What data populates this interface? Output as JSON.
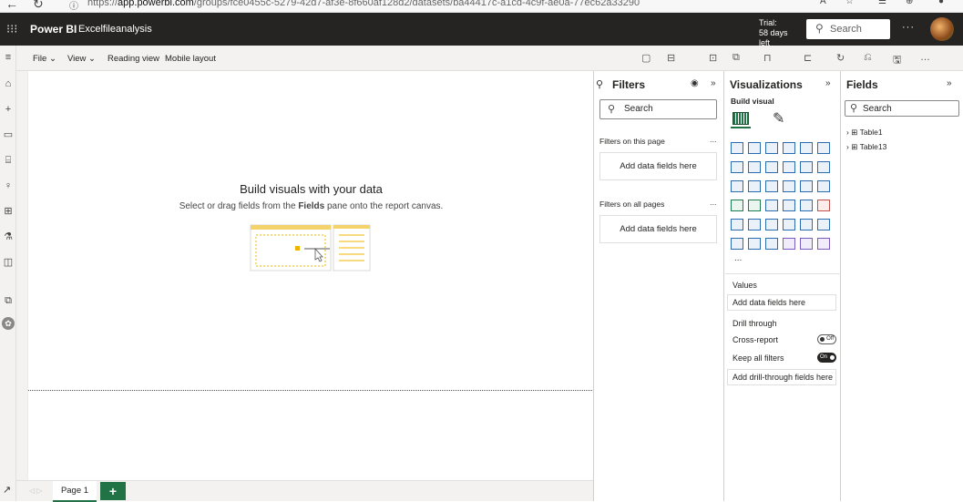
{
  "browser": {
    "url_prefix": "https://",
    "url_host": "app.powerbi.com",
    "url_path": "/groups/fce0455c-5279-42d7-af3e-8f660af128d2/datasets/ba44417c-a1cd-4c9f-ae0a-77ec62a33290"
  },
  "header": {
    "app_name": "Power BI",
    "report_name": "Excelfileanalysis",
    "trial_label": "Trial:",
    "trial_days": "58 days left",
    "search_placeholder": "Search",
    "more": "···"
  },
  "ribbon": {
    "file": "File ⌄",
    "view": "View ⌄",
    "reading_view": "Reading view",
    "mobile_layout": "Mobile layout"
  },
  "canvas": {
    "empty_title": "Build visuals with your data",
    "empty_sub_before": "Select or drag fields from the",
    "empty_sub_bold": "Fields",
    "empty_sub_after": "pane onto the report canvas."
  },
  "page_tabs": {
    "tabs": [
      "Page 1"
    ],
    "add": "+"
  },
  "filters": {
    "title": "Filters",
    "search_placeholder": "Search",
    "on_this_page": "Filters on this page",
    "on_all_pages": "Filters on all pages",
    "add_fields": "Add data fields here",
    "more": "..."
  },
  "visualizations": {
    "title": "Visualizations",
    "build_visual": "Build visual",
    "more": "...",
    "values_label": "Values",
    "add_fields": "Add data fields here",
    "drill_through": "Drill through",
    "cross_report": "Cross-report",
    "cross_report_state": "Off",
    "keep_all_filters": "Keep all filters",
    "keep_all_filters_state": "On",
    "add_drill_fields": "Add drill-through fields here"
  },
  "fields": {
    "title": "Fields",
    "search_placeholder": "Search",
    "tables": [
      "Table1",
      "Table13"
    ]
  },
  "colors": {
    "header_bg": "#252423",
    "accent": "#217346",
    "pane_border": "#d2d0ce"
  }
}
